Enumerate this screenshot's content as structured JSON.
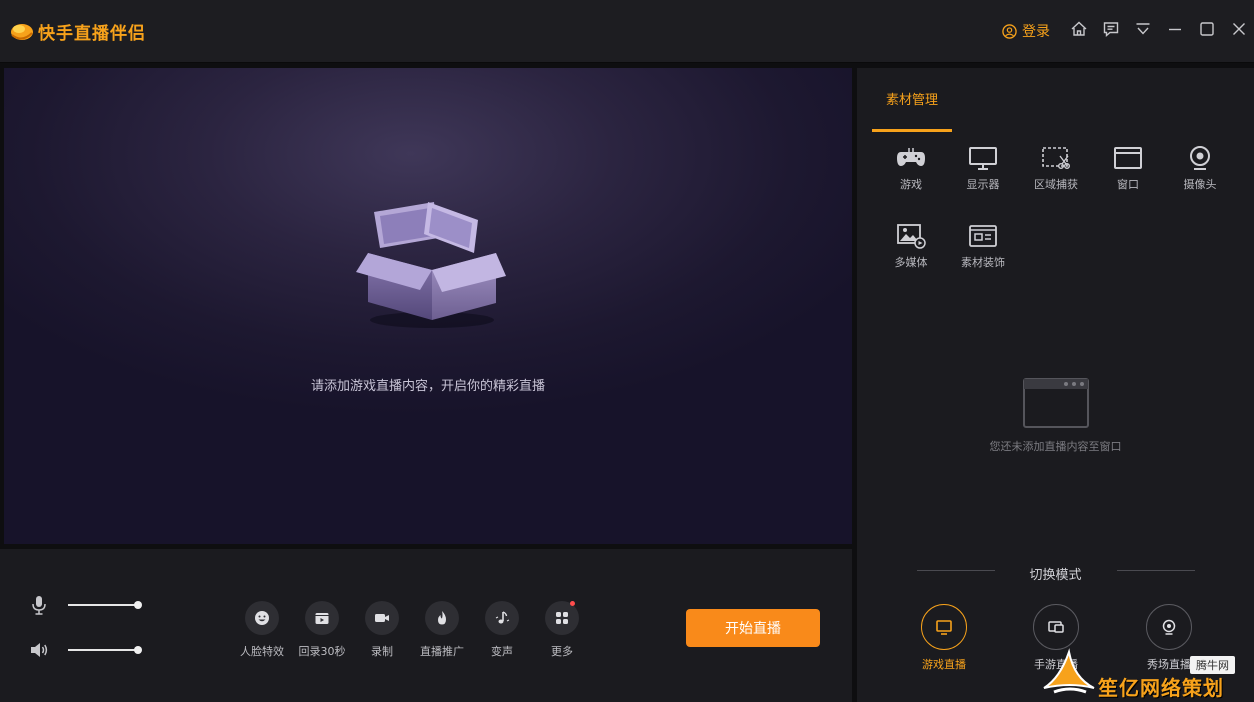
{
  "app": {
    "title": "快手直播伴侣"
  },
  "titlebar": {
    "login_label": "登录",
    "icons": [
      "home-icon",
      "feedback-icon",
      "menu-icon",
      "minimize-icon",
      "maximize-icon",
      "close-icon"
    ]
  },
  "preview": {
    "hint": "请添加游戏直播内容，开启你的精彩直播"
  },
  "bottom": {
    "tools": [
      {
        "label": "人脸特效",
        "icon": "face-effect-icon"
      },
      {
        "label": "回录30秒",
        "icon": "replay-icon"
      },
      {
        "label": "录制",
        "icon": "record-icon"
      },
      {
        "label": "直播推广",
        "icon": "flame-icon"
      },
      {
        "label": "变声",
        "icon": "voice-change-icon"
      },
      {
        "label": "更多",
        "icon": "more-grid-icon"
      }
    ],
    "start_label": "开始直播",
    "mic_level": 1.0,
    "speaker_level": 1.0
  },
  "panel": {
    "tab": "素材管理",
    "sources": [
      {
        "label": "游戏",
        "icon": "gamepad-icon"
      },
      {
        "label": "显示器",
        "icon": "monitor-icon"
      },
      {
        "label": "区域捕获",
        "icon": "region-capture-icon"
      },
      {
        "label": "窗口",
        "icon": "window-icon"
      },
      {
        "label": "摄像头",
        "icon": "camera-icon"
      },
      {
        "label": "多媒体",
        "icon": "media-icon"
      },
      {
        "label": "素材装饰",
        "icon": "decoration-icon"
      }
    ],
    "empty_hint": "您还未添加直播内容至窗口",
    "mode_title": "切换模式",
    "modes": [
      {
        "label": "游戏直播",
        "active": true
      },
      {
        "label": "手游直播",
        "active": false
      },
      {
        "label": "秀场直播",
        "active": false
      }
    ]
  },
  "watermark": {
    "badge": "腾牛网",
    "text": "笙亿网络策划"
  },
  "colors": {
    "accent": "#f7a21b",
    "button": "#f98a1a"
  }
}
